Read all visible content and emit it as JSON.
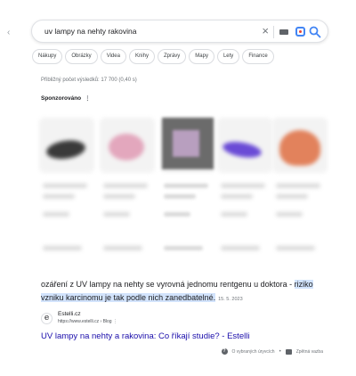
{
  "search": {
    "query": "uv lampy na nehty rakovina",
    "back_icon": "‹",
    "clear_icon": "×"
  },
  "chips": [
    "Nákupy",
    "Obrázky",
    "Videa",
    "Knihy",
    "Zprávy",
    "Mapy",
    "Lety",
    "Finance"
  ],
  "result_stats": "Přibližný počet výsledků: 17 700 (0,40 s)",
  "sponsored": {
    "label": "Sponzorováno",
    "menu": "⋮"
  },
  "ads": {
    "cards": [
      {
        "icon": "black-uv-lamp-image"
      },
      {
        "icon": "pink-uv-lamp-image"
      },
      {
        "icon": "product-photo-image"
      },
      {
        "icon": "purple-uv-lamp-image"
      },
      {
        "icon": "orange-uv-lamp-image"
      }
    ]
  },
  "snippet": {
    "text_plain": "ozáření z UV lampy na nehty se vyrovná jednomu rentgenu u doktora -",
    "text_highlight": "riziko vzniku karcinomu je tak podle nich zanedbatelné.",
    "date": "15. 5. 2023"
  },
  "source": {
    "favicon_letter": "e",
    "site": "Estelli.cz",
    "url": "https://www.estelli.cz › Blog",
    "menu": "⋮"
  },
  "result_title": "UV lampy na nehty a rakovina: Co říkají studie? - Estelli",
  "footer": {
    "about": "O vybraných úryvcích",
    "separator": "•",
    "feedback": "Zpětná vazba"
  },
  "colors": {
    "link": "#1a0dab",
    "highlight": "#d2e3fc",
    "text": "#202124",
    "muted": "#70757a"
  }
}
